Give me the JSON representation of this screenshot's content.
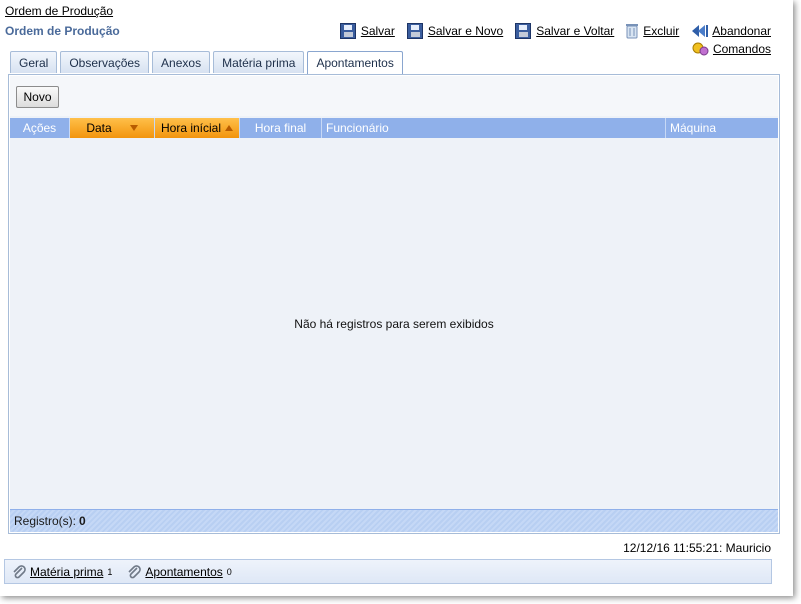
{
  "breadcrumb": "Ordem de Produção",
  "page_title": "Ordem de Produção",
  "toolbar": {
    "save_label": "Salvar",
    "save_new_label": "Salvar e Novo",
    "save_back_label": "Salvar e Voltar",
    "delete_label": "Excluir",
    "abandon_label": "Abandonar",
    "commands_label": "Comandos"
  },
  "tabs": [
    {
      "label": "Geral"
    },
    {
      "label": "Observações"
    },
    {
      "label": "Anexos"
    },
    {
      "label": "Matéria prima"
    },
    {
      "label": "Apontamentos",
      "active": true
    }
  ],
  "grid": {
    "new_button": "Novo",
    "columns": [
      "Ações",
      "Data",
      "Hora inícial",
      "Hora final",
      "Funcionário",
      "Máquina"
    ],
    "sorted_columns": {
      "Data": "desc",
      "Hora inícial": "asc"
    },
    "empty_message": "Não há registros para serem exibidos",
    "records_label": "Registro(s):",
    "records_count": "0"
  },
  "timestamp": "12/12/16 11:55:21: Mauricio",
  "related": [
    {
      "label": "Matéria prima",
      "count": "1"
    },
    {
      "label": "Apontamentos",
      "count": "0"
    }
  ],
  "colors": {
    "header_blue": "#8fb0ea",
    "sorted_orange": "#f2940d",
    "title_blue": "#4a6a9a"
  }
}
